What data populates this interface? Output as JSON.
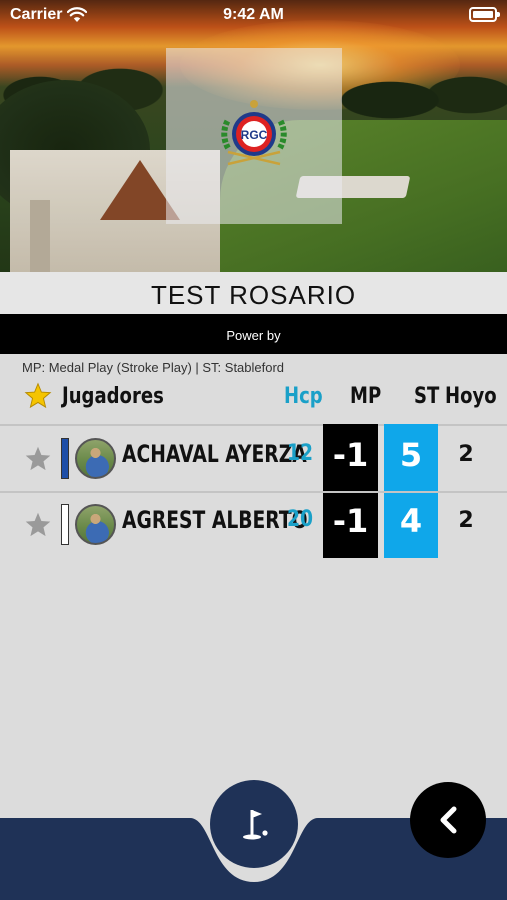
{
  "status_bar": {
    "carrier": "Carrier",
    "time": "9:42 AM"
  },
  "header": {
    "logo_text": "RGC",
    "title": "TEST ROSARIO",
    "powered_by": "Power by"
  },
  "legend": "MP: Medal Play (Stroke Play) | ST: Stableford",
  "table": {
    "columns": {
      "players": "Jugadores",
      "hcp": "Hcp",
      "mp": "MP",
      "st": "ST",
      "hoyo": "Hoyo"
    },
    "rows": [
      {
        "name": "ACHAVAL AYERZA",
        "hcp": "12",
        "mp": "-1",
        "st": "5",
        "hoyo": "2",
        "tee_color": "#1d4ea8"
      },
      {
        "name": "AGREST ALBERTO",
        "hcp": "20",
        "mp": "-1",
        "st": "4",
        "hoyo": "2",
        "tee_color": "#ffffff"
      }
    ]
  },
  "colors": {
    "accent": "#1aa0c8",
    "st_column": "#0fa7ea",
    "mp_column": "#000000",
    "bottom_bar": "#1f3257",
    "favorite_star": "#f5c400",
    "inactive_star": "#9a9a9a"
  },
  "icons": {
    "wifi": "wifi-icon",
    "battery": "battery-icon",
    "favorites": "star-icon",
    "golf": "golf-flag-icon",
    "back": "chevron-left-icon"
  }
}
